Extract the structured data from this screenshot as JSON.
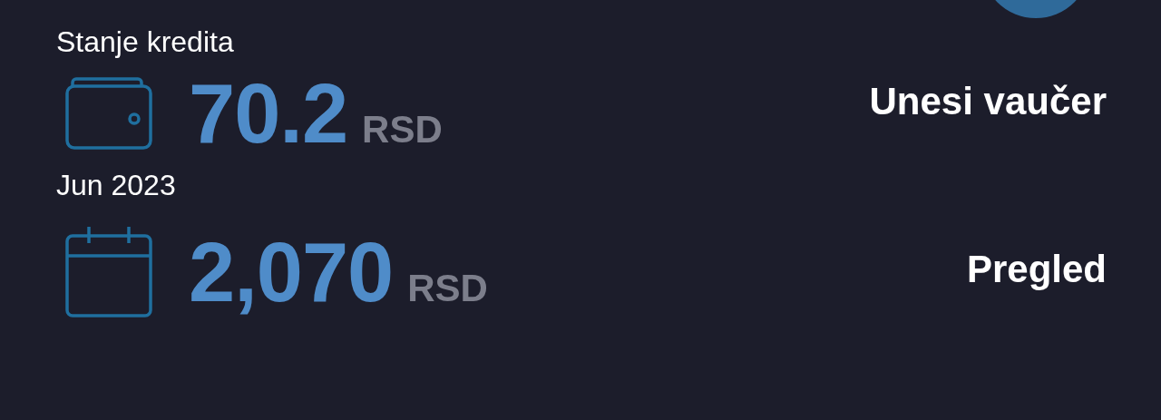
{
  "rows": [
    {
      "kind": "wallet",
      "label": "Stanje kredita",
      "amount": "70.2",
      "currency": "RSD",
      "action": "Unesi vaučer"
    },
    {
      "kind": "calendar",
      "label": "Jun 2023",
      "amount": "2,070",
      "currency": "RSD",
      "action": "Pregled"
    }
  ]
}
